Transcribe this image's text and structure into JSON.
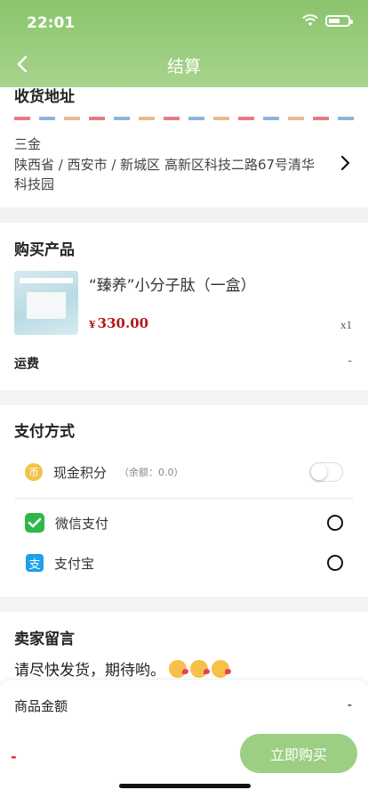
{
  "status_bar": {
    "time": "22:01"
  },
  "nav": {
    "title": "结算"
  },
  "address": {
    "title": "收货地址",
    "name": "三金",
    "line": "陕西省 / 西安市 / 新城区 高新区科技二路67号清华科技园"
  },
  "products": {
    "title": "购买产品",
    "items": [
      {
        "name": "“臻养”小分子肽（一盒）",
        "currency": "¥",
        "price": "330.00",
        "qty": "x1"
      }
    ],
    "shipping_label": "运费",
    "shipping_value": "-"
  },
  "payment": {
    "title": "支付方式",
    "points": {
      "label": "现金积分",
      "icon_char": "币",
      "balance": "（余额：0.0）",
      "enabled": false
    },
    "wechat": {
      "label": "微信支付"
    },
    "alipay": {
      "label": "支付宝",
      "icon_char": "支"
    }
  },
  "message": {
    "title": "卖家留言",
    "text": "请尽快发货，期待哟。"
  },
  "footer": {
    "total_label": "商品金额",
    "total_value": "-",
    "pay_amount": "-",
    "buy_label": "立即购买"
  },
  "colors": {
    "accent": "#8bc46c",
    "price": "#b4151b",
    "button": "#9ccf83"
  }
}
